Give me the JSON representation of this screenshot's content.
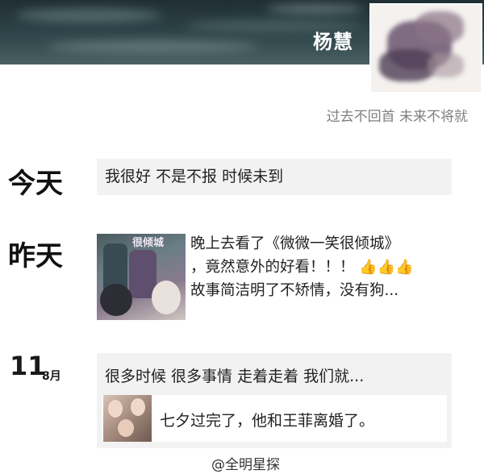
{
  "profile": {
    "name": "杨慧",
    "signature": "过去不回首 未来不将就"
  },
  "feed": {
    "today_label": "今天",
    "today_post": "我很好 不是不报 时候未到",
    "yesterday_label": "昨天",
    "yesterday_post": {
      "line1": "晚上去看了《微微一笑很倾城》",
      "line2": "，竟然意外的好看！！！",
      "line2_emoji": "👍👍👍",
      "line3": "故事简洁明了不矫情，没有狗...",
      "thumbnail_title": "很倾城"
    },
    "date_day": "11",
    "date_month": "8月",
    "date_post": {
      "text": "很多时候 很多事情 走着走着 我们就...",
      "shared_text": "七夕过完了，他和王菲离婚了。"
    }
  },
  "watermark": "@全明星探",
  "colors": {
    "cover_dark": "#1f2e33",
    "post_background": "#f2f2f2",
    "signature_gray": "#7f7f7f",
    "thumbs_up": "#e8902a"
  }
}
